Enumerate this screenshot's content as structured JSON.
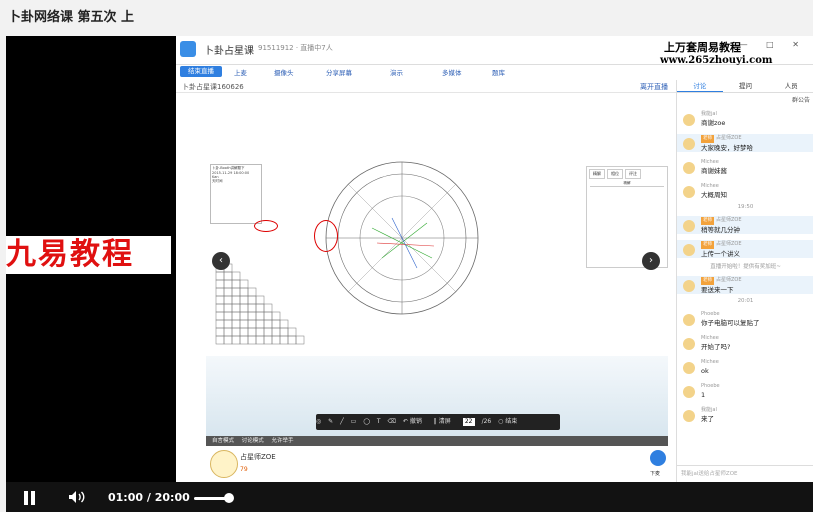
{
  "page": {
    "title": "卜卦网络课 第五次 上"
  },
  "app": {
    "title": "卜卦占星课",
    "subtitle": "91511912 · 直播中7人",
    "watermark_line1": "上万套周易教程",
    "watermark_line2": "www.265zhouyi.com",
    "window_controls": "— □ ✕"
  },
  "toolbar": {
    "end_live": "结束直播",
    "items": [
      "上麦",
      "摄像头",
      "分享屏幕",
      "演示",
      "多媒体",
      "题库"
    ]
  },
  "course": {
    "name": "卜卦占星课160626",
    "leave": "离开直播"
  },
  "board": {
    "info_lines": [
      "卜卦-Booth讲解题下",
      "2015-11-29 18:00:00",
      "Kan",
      "天时间"
    ],
    "table_tabs": [
      "精解",
      "相位",
      "评注"
    ],
    "table_header": "精解"
  },
  "drawbar": {
    "undo": "撤销",
    "clear": "清屏",
    "page": "22",
    "total": "/26",
    "end": "结束"
  },
  "modebar": {
    "items": [
      "自言模式",
      "讨论模式",
      "允许举手"
    ]
  },
  "teacher": {
    "name": "占星师ZOE",
    "count": "79",
    "hand_label": "下麦"
  },
  "side": {
    "tabs": [
      "讨论",
      "提问",
      "人员"
    ],
    "announce": "群公告",
    "messages": [
      {
        "name": "我能jal",
        "text": "商谢zoe",
        "badge": "",
        "hi": false
      },
      {
        "name": "占星师ZOE",
        "text": "大家晚安，好梦哈",
        "badge": "老师",
        "hi": true
      },
      {
        "name": "Michee",
        "text": "商谢妹酱",
        "badge": "",
        "hi": false
      },
      {
        "name": "Michee",
        "text": "大概周知",
        "badge": "",
        "hi": false
      },
      {
        "name": "占星师ZOE",
        "text": "稍等就几分钟",
        "badge": "老师",
        "hi": true
      },
      {
        "name": "占星师ZOE",
        "text": "上传一个讲义",
        "badge": "老师",
        "hi": true
      },
      {
        "name": "占星师ZOE",
        "text": "要送来一下",
        "badge": "老师",
        "hi": true
      },
      {
        "name": "Phoebe",
        "text": "你子电脑可以复贴了",
        "badge": "",
        "hi": false
      },
      {
        "name": "Michee",
        "text": "开始了吗?",
        "badge": "",
        "hi": false
      },
      {
        "name": "Michee",
        "text": "ok",
        "badge": "",
        "hi": false
      },
      {
        "name": "Phoebe",
        "text": "1",
        "badge": "",
        "hi": false
      },
      {
        "name": "我能jal",
        "text": "来了",
        "badge": "",
        "hi": false
      }
    ],
    "time_a": "19:50",
    "time_b": "20:01",
    "system_note": "直播开始啦！提供有奖加班~",
    "input_placeholder": "我能jal送给占星师ZOE"
  },
  "overlay": {
    "jiuyi": "九易教程"
  },
  "player": {
    "current": "01:00",
    "separator": "/",
    "duration": "20:00",
    "progress": 0.05
  }
}
